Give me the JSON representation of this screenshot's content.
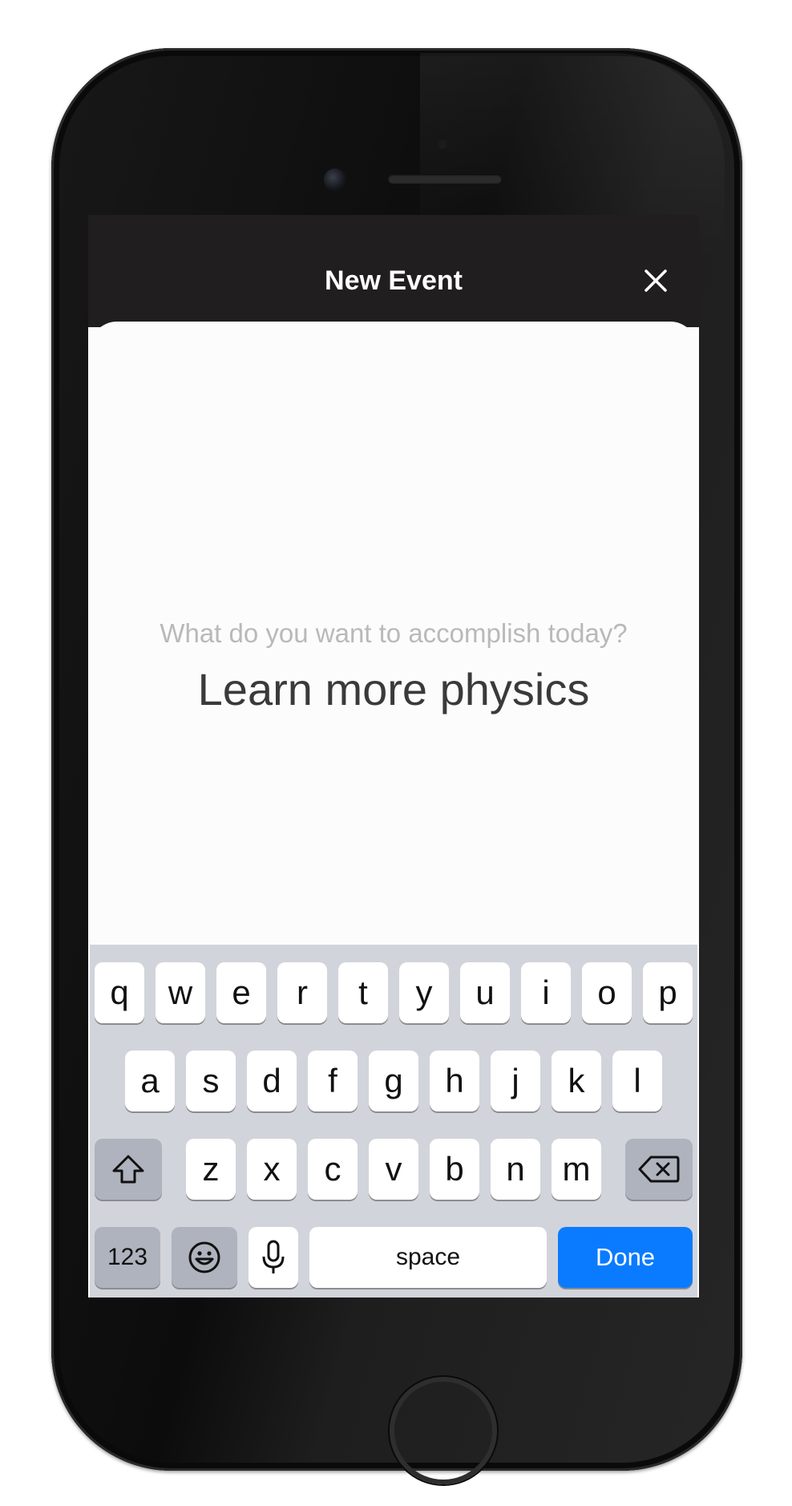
{
  "header": {
    "title": "New Event"
  },
  "main": {
    "prompt": "What do you want to accomplish today?",
    "answer": "Learn more physics"
  },
  "keyboard": {
    "row1": [
      "q",
      "w",
      "e",
      "r",
      "t",
      "y",
      "u",
      "i",
      "o",
      "p"
    ],
    "row2": [
      "a",
      "s",
      "d",
      "f",
      "g",
      "h",
      "j",
      "k",
      "l"
    ],
    "row3": [
      "z",
      "x",
      "c",
      "v",
      "b",
      "n",
      "m"
    ],
    "numbers_label": "123",
    "space_label": "space",
    "done_label": "Done"
  },
  "colors": {
    "navbar": "#201e1e",
    "done_key": "#0a7bff",
    "keyboard_bg": "#d2d4db"
  },
  "icons": [
    "close-icon",
    "shift-icon",
    "delete-icon",
    "emoji-icon",
    "microphone-icon"
  ]
}
